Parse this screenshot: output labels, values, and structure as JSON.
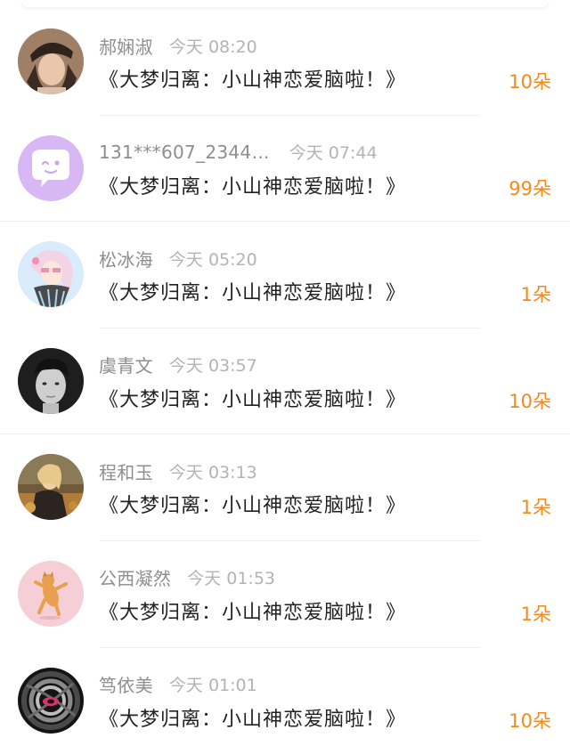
{
  "accent_color": "#f28a1e",
  "gifts": [
    {
      "user": "郝娴淑",
      "time": "今天 08:20",
      "message": "《大梦归离：小山神恋爱脑啦！》",
      "count": "10朵",
      "avatar": "woman-hat-avatar"
    },
    {
      "user": "131***607_2344…",
      "time": "今天 07:44",
      "message": "《大梦归离：小山神恋爱脑啦！》",
      "count": "99朵",
      "avatar": "default-chat-bubble-avatar"
    },
    {
      "user": "松冰海",
      "time": "今天 05:20",
      "message": "《大梦归离：小山神恋爱脑啦！》",
      "count": "1朵",
      "avatar": "anime-girl-avatar"
    },
    {
      "user": "虞青文",
      "time": "今天 03:57",
      "message": "《大梦归离：小山神恋爱脑啦！》",
      "count": "10朵",
      "avatar": "man-portrait-avatar"
    },
    {
      "user": "程和玉",
      "time": "今天 03:13",
      "message": "《大梦归离：小山神恋爱脑啦！》",
      "count": "1朵",
      "avatar": "woman-autumn-avatar"
    },
    {
      "user": "公西凝然",
      "time": "今天 01:53",
      "message": "《大梦归离：小山神恋爱脑啦！》",
      "count": "1朵",
      "avatar": "dancing-cat-avatar"
    },
    {
      "user": "笃依美",
      "time": "今天 01:01",
      "message": "《大梦归离：小山神恋爱脑啦！》",
      "count": "10朵",
      "avatar": "spiral-eye-avatar"
    }
  ]
}
